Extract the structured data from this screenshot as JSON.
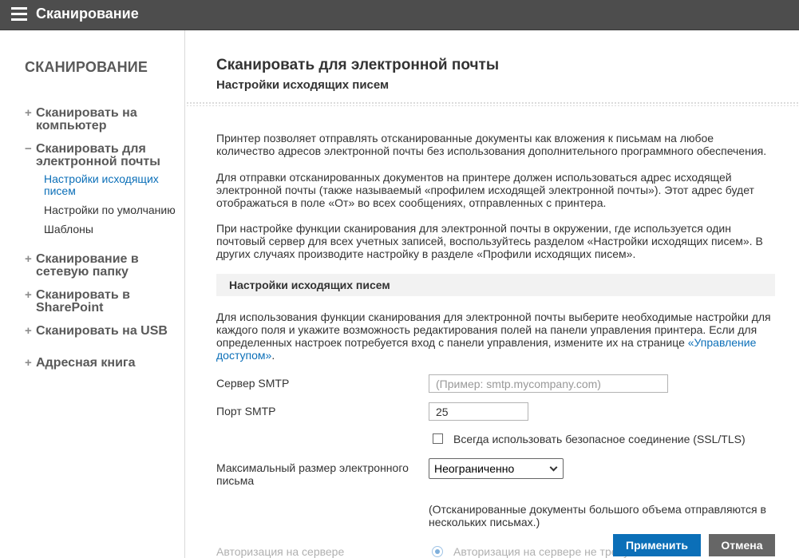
{
  "header": {
    "title": "Сканирование"
  },
  "sidebar": {
    "heading": "СКАНИРОВАНИЕ",
    "items": [
      {
        "sign": "+",
        "label": "Сканировать на компьютер"
      },
      {
        "sign": "−",
        "label": "Сканировать для электронной почты",
        "children": [
          {
            "label": "Настройки исходящих писем",
            "active": true
          },
          {
            "label": "Настройки по умолчанию"
          },
          {
            "label": "Шаблоны"
          }
        ]
      },
      {
        "sign": "+",
        "label": "Сканирование в сетевую папку"
      },
      {
        "sign": "+",
        "label": "Сканировать в SharePoint"
      },
      {
        "sign": "+",
        "label": "Сканировать на USB"
      },
      {
        "sign": "+",
        "label": "Адресная книга"
      }
    ]
  },
  "main": {
    "title": "Сканировать для электронной почты",
    "subtitle": "Настройки исходящих писем",
    "intro": [
      "Принтер позволяет отправлять отсканированные документы как вложения к письмам на любое количество адресов электронной почты без использования дополнительного программного обеспечения.",
      "Для отправки отсканированных документов на принтере должен использоваться адрес исходящей электронной почты (также называемый «профилем исходящей электронной почты»). Этот адрес будет отображаться в поле «От» во всех сообщениях, отправленных с принтера.",
      "При настройке функции сканирования для электронной почты в окружении, где используется один почтовый сервер для всех учетных записей, воспользуйтесь разделом «Настройки исходящих писем». В других случаях производите настройку в разделе «Профили исходящих писем»."
    ],
    "section_title": "Настройки исходящих писем",
    "section_text": "Для использования функции сканирования для электронной почты выберите необходимые настройки для каждого поля и укажите возможность редактирования полей на панели управления принтера. Если для определенных настроек потребуется вход с панели управления, измените их на странице ",
    "section_link": "«Управление доступом»",
    "section_text_end": ".",
    "smtp_server": {
      "label": "Сервер SMTP",
      "value": "",
      "placeholder": "(Пример: smtp.mycompany.com)"
    },
    "smtp_port": {
      "label": "Порт SMTP",
      "value": "25"
    },
    "ssl": {
      "label": "Всегда использовать безопасное соединение (SSL/TLS)",
      "checked": false
    },
    "max_size": {
      "label": "Максимальный размер электронного письма",
      "selected": "Неограниченно"
    },
    "max_size_note": "(Отсканированные документы большого объема отправляются в нескольких письмах.)",
    "server_auth": {
      "label": "Авторизация на сервере",
      "option": "Авторизация на сервере не требуется"
    }
  },
  "buttons": {
    "apply": "Применить",
    "cancel": "Отмена"
  },
  "colors": {
    "topbar": "#4d4d4d",
    "accent": "#0b6fb8",
    "cancel": "#666666"
  }
}
